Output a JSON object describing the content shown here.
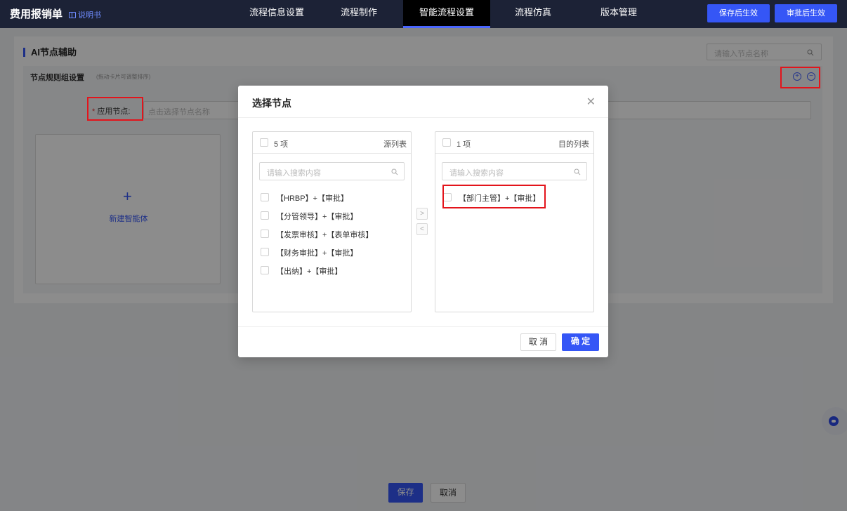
{
  "header": {
    "app_title": "费用报销单",
    "manual_link": "说明书",
    "tabs": [
      {
        "label": "流程信息设置"
      },
      {
        "label": "流程制作"
      },
      {
        "label": "智能流程设置"
      },
      {
        "label": "流程仿真"
      },
      {
        "label": "版本管理"
      }
    ],
    "active_tab": "智能流程设置",
    "save_effective_label": "保存后生效",
    "approve_effective_label": "审批后生效"
  },
  "page": {
    "section_title": "AI节点辅助",
    "search_placeholder": "请输入节点名称",
    "rule_group_title": "节点规则组设置",
    "rule_group_hint": "(拖动卡片可调整排序)",
    "apply_node_label": "应用节点:",
    "apply_node_required": "*",
    "apply_node_placeholder": "点击选择节点名称",
    "new_agent_label": "新建智能体"
  },
  "footer": {
    "save_label": "保存",
    "cancel_label": "取消"
  },
  "modal": {
    "title": "选择节点",
    "source": {
      "count": "5 项",
      "name": "源列表",
      "search_placeholder": "请输入搜索内容",
      "items": [
        "【HRBP】+【审批】",
        "【分管领导】+【审批】",
        "【发票审核】+【表单审核】",
        "【财务审批】+【审批】",
        "【出纳】+【审批】"
      ]
    },
    "target": {
      "count": "1 项",
      "name": "目的列表",
      "search_placeholder": "请输入搜索内容",
      "items": [
        "【部门主管】+【审批】"
      ]
    },
    "move_right": ">",
    "move_left": "<",
    "cancel_label": "取 消",
    "confirm_label": "确 定"
  },
  "colors": {
    "topbar": "#1c2236",
    "accent": "#3556f6",
    "highlight": "#e3141b"
  }
}
